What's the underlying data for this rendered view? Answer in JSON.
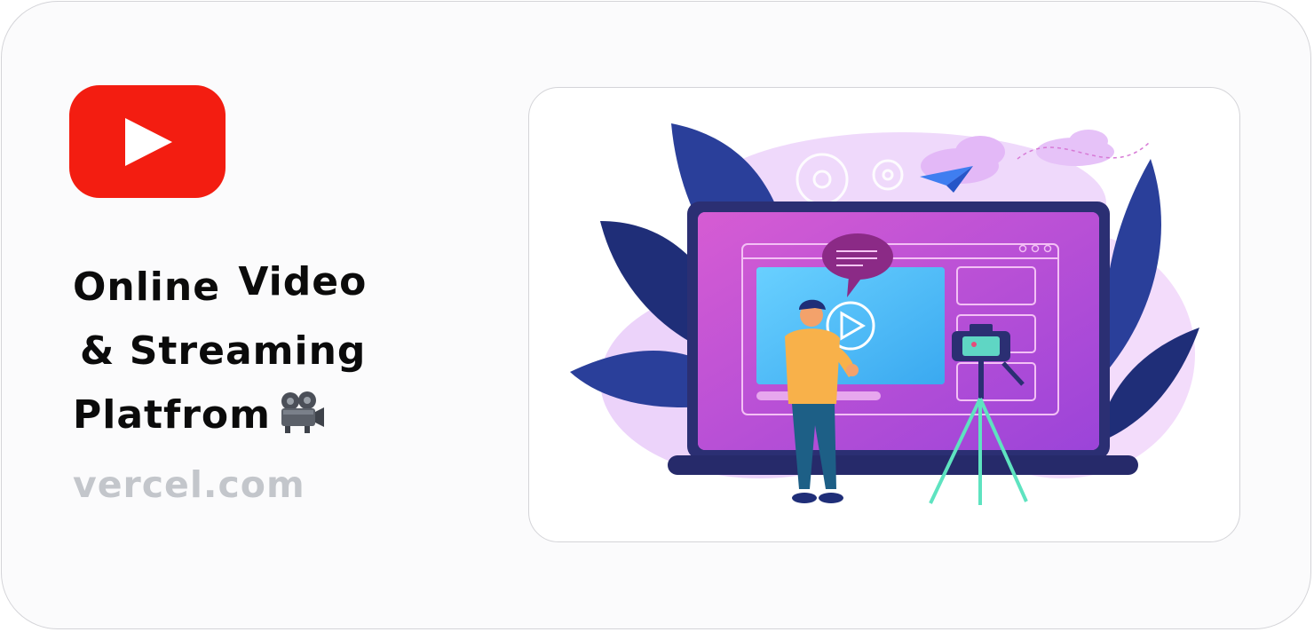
{
  "title": {
    "line1_word1": "Online",
    "line1_word2": "Video",
    "line2": "& Streaming",
    "line3": "Platfrom"
  },
  "domain": "vercel.com",
  "icons": {
    "logo": "play-button-logo-icon",
    "title_emoji": "movie-camera-icon",
    "illustration": "video-creator-illustration"
  },
  "colors": {
    "logo_red": "#f31d11",
    "domain_gray": "#c3c6cb",
    "title_black": "#0b0b0b",
    "screen_magenta": "#c64fd0",
    "leaf_blue": "#26358f"
  }
}
